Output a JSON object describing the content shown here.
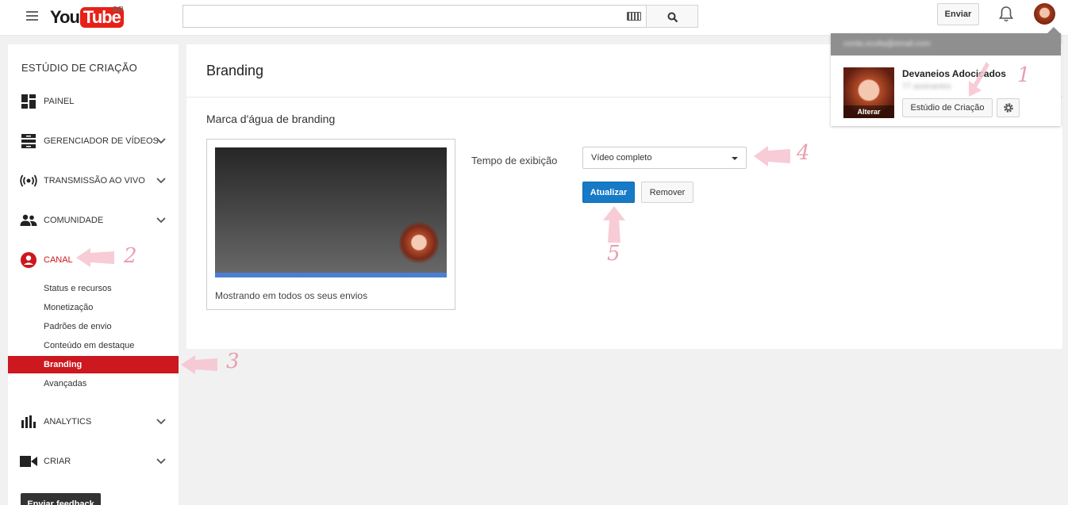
{
  "header": {
    "logo_you": "You",
    "logo_tube": "Tube",
    "region": "BR",
    "search_placeholder": "",
    "upload_label": "Enviar"
  },
  "sidebar": {
    "title": "ESTÚDIO DE CRIAÇÃO",
    "items": [
      {
        "label": "PAINEL",
        "icon": "dashboard-icon"
      },
      {
        "label": "GERENCIADOR DE VÍDEOS",
        "icon": "video-manager-icon"
      },
      {
        "label": "TRANSMISSÃO AO VIVO",
        "icon": "live-icon"
      },
      {
        "label": "COMUNIDADE",
        "icon": "community-icon"
      },
      {
        "label": "CANAL",
        "icon": "channel-icon"
      },
      {
        "label": "ANALYTICS",
        "icon": "analytics-icon"
      },
      {
        "label": "CRIAR",
        "icon": "create-icon"
      }
    ],
    "channel_subitems": [
      "Status e recursos",
      "Monetização",
      "Padrões de envio",
      "Conteúdo em destaque",
      "Branding",
      "Avançadas"
    ],
    "selected_subitem": "Branding",
    "feedback_label": "Enviar feedback"
  },
  "main": {
    "page_title": "Branding",
    "section_title": "Marca d'água de branding",
    "preview_caption": "Mostrando em todos os seus envios",
    "field_label": "Tempo de exibição",
    "select_value": "Vídeo completo",
    "update_label": "Atualizar",
    "remove_label": "Remover"
  },
  "account_popup": {
    "email": "conta.oculta@email.com",
    "channel_name": "Devaneios Adocicados",
    "subscribers": "77 assinantes",
    "avatar_label": "Alterar",
    "studio_label": "Estúdio de Criação"
  },
  "annotations": [
    "1",
    "2",
    "3",
    "4",
    "5"
  ],
  "colors": {
    "brand_red": "#cc181e",
    "primary_blue": "#167ac6",
    "annotation_pink": "#e8a0b0"
  }
}
